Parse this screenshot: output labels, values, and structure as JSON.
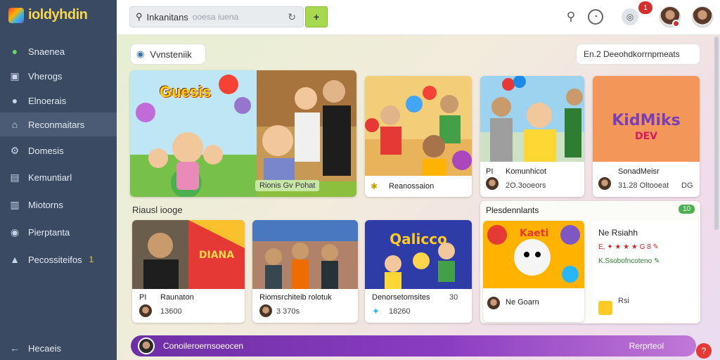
{
  "app": {
    "name": "ioldyhdin"
  },
  "sidebar": {
    "items": [
      {
        "label": "Snaenea",
        "icon": "leaf-icon"
      },
      {
        "label": "Vherogs",
        "icon": "window-icon"
      },
      {
        "label": "Elnoerais",
        "icon": "user-icon"
      },
      {
        "label": "Reconmaitars",
        "icon": "home-icon"
      },
      {
        "label": "Domesis",
        "icon": "gear-icon"
      },
      {
        "label": "Kemuntiarl",
        "icon": "window-icon"
      },
      {
        "label": "Miotorns",
        "icon": "chart-icon"
      },
      {
        "label": "Pierptanta",
        "icon": "palette-icon"
      },
      {
        "label": "Pecossiteifos",
        "icon": "person-icon",
        "badge": "1"
      }
    ],
    "footer": {
      "label": "Hecaeis"
    }
  },
  "header": {
    "search": {
      "value": "Inkanitans",
      "placeholder": "ooesa iuena"
    },
    "add_label": "+",
    "notification_count": "1"
  },
  "main": {
    "filter_pill": "Vvnsteniik",
    "sort_pill": "En.2 Deeohdkorrnpmeats",
    "featured": {
      "title_art": "Guesis",
      "caption": "Rionis Gv Pohat"
    },
    "top_cards": [
      {
        "title": "Reanossaion",
        "icon": "star-icon"
      },
      {
        "title": "Komunhicot",
        "prefix": "PI",
        "meta": "2O.3ooeors"
      },
      {
        "title": "SonadMeisr",
        "meta": "31.28 Oltooeat",
        "meta2": "DG"
      }
    ],
    "section_title": "Riausl iooge",
    "mid_cards": [
      {
        "title": "Raunaton",
        "prefix": "PI",
        "meta": "13600"
      },
      {
        "title": "Riomsrchiteib rolotuk",
        "meta": "3 370s"
      },
      {
        "title": "Denorsetomsites",
        "meta": "18260",
        "meta2": "30"
      },
      {
        "title": "Ne Goarn"
      },
      {
        "title": "Rsi"
      }
    ],
    "panel": {
      "title": "Plesdennlants",
      "badge": "10",
      "heading": "Ne Rsiahh",
      "line1": "E,  ✦ ★ ★ ★ G  8  ✎",
      "line2": "K.Ssobofncoteno ✎"
    },
    "banner": {
      "left": "Conoileroernsoeocen",
      "right": "Rerprteol"
    }
  },
  "colors": {
    "sidebar_bg": "#3a4a63",
    "accent_green": "#a6d94f",
    "banner_purple": "#7a35b5",
    "notification_red": "#d32f2f"
  }
}
